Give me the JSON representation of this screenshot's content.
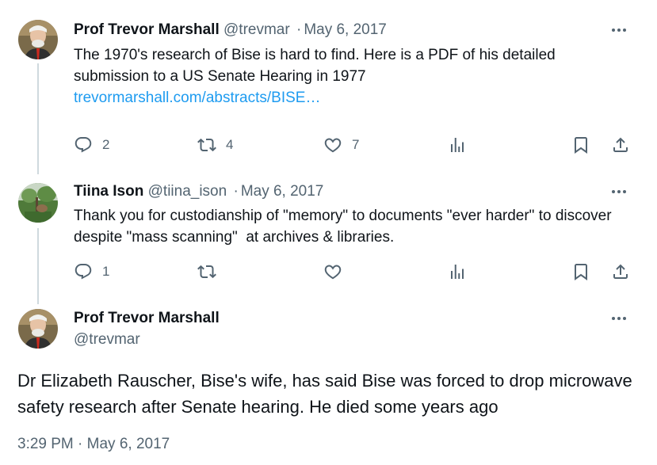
{
  "tweet1": {
    "author_name": "Prof Trevor Marshall",
    "handle": "@trevmar",
    "date": "May 6, 2017",
    "separator": "·",
    "text": "The 1970's research of Bise is hard to find. Here is a PDF of his detailed submission to a US Senate Hearing in 1977",
    "link": "trevormarshall.com/abstracts/BISE…",
    "reply_count": "2",
    "retweet_count": "4",
    "like_count": "7",
    "more_icon": "more-dots-icon"
  },
  "tweet2": {
    "author_name": "Tiina Ison",
    "handle": "@tiina_ison",
    "date": "May 6, 2017",
    "separator": "·",
    "text": "Thank you for custodianship of \"memory\" to documents \"ever harder\" to discover despite \"mass scanning\"  at archives & libraries.",
    "reply_count": "1",
    "more_icon": "more-dots-icon"
  },
  "main_tweet": {
    "author_name": "Prof Trevor Marshall",
    "handle": "@trevmar",
    "text": "Dr Elizabeth Rauscher, Bise's wife, has said Bise was forced to drop microwave safety research after Senate hearing. He died some years ago",
    "timestamp": "3:29 PM · May 6, 2017"
  },
  "colors": {
    "text_primary": "#0f1419",
    "text_secondary": "#536471",
    "link": "#1d9bf0",
    "thread_line": "#cfd9de"
  },
  "icons": [
    "reply-icon",
    "retweet-icon",
    "like-icon",
    "views-icon",
    "bookmark-icon",
    "share-icon"
  ]
}
